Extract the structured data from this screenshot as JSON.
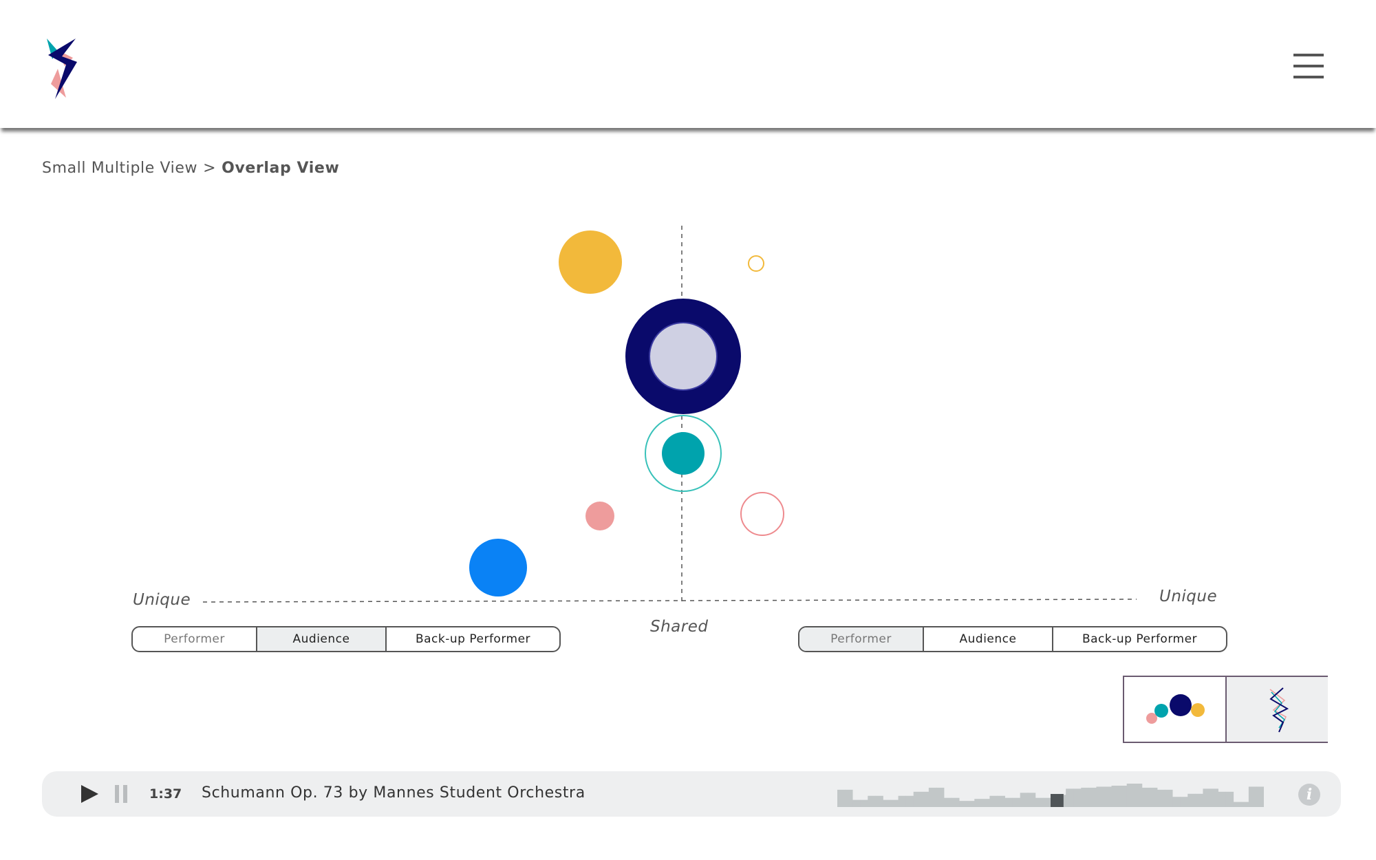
{
  "header": {
    "logo_icon": "lightning-logo-icon",
    "menu_icon": "hamburger-menu-icon"
  },
  "breadcrumb": {
    "parent": "Small Multiple View",
    "separator": ">",
    "current": "Overlap View"
  },
  "axis": {
    "left_label": "Unique",
    "right_label": "Unique",
    "center_label": "Shared"
  },
  "left_roles": {
    "options": [
      "Performer",
      "Audience",
      "Back-up Performer"
    ],
    "selected": "Audience"
  },
  "right_roles": {
    "options": [
      "Performer",
      "Audience",
      "Back-up Performer"
    ],
    "selected": "Performer"
  },
  "view_toggle": {
    "options": [
      {
        "name": "bubble-view-icon",
        "active": false
      },
      {
        "name": "line-view-icon",
        "active": true
      }
    ]
  },
  "player": {
    "play_icon": "play-icon",
    "pause_icon": "pause-icon",
    "time": "1:37",
    "title": "Schumann Op. 73 by Mannes Student Orchestra",
    "info_icon": "info-icon",
    "waveform_levels": [
      0.85,
      0.85,
      0.35,
      0.35,
      0.55,
      0.55,
      0.35,
      0.35,
      0.55,
      0.55,
      0.75,
      0.75,
      0.95,
      0.95,
      0.45,
      0.45,
      0.3,
      0.3,
      0.4,
      0.4,
      0.55,
      0.55,
      0.45,
      0.45,
      0.7,
      0.7,
      0.45,
      0.45,
      0.6,
      0.6,
      0.9,
      0.9,
      0.95,
      0.95,
      1.0,
      1.0,
      1.05,
      1.05,
      1.15,
      1.15,
      0.95,
      0.95,
      0.85,
      0.85,
      0.5,
      0.5,
      0.65,
      0.65,
      0.9,
      0.9,
      0.75,
      0.75,
      0.25,
      0.25,
      1.0,
      1.0
    ],
    "playhead_index": 28
  },
  "colors": {
    "navy": "#0a0a6b",
    "lavender": "#cfd0e3",
    "teal": "#00a3ad",
    "teal_ring": "#38c1b9",
    "pink": "#ee9c9c",
    "pink_ring": "#ee8a8e",
    "yellow": "#f2b93b",
    "yellow_ring": "#f2b93b",
    "blue": "#0a82f5",
    "axis": "#555555",
    "waveform": "#c2c7c8",
    "playhead": "#505558"
  }
}
